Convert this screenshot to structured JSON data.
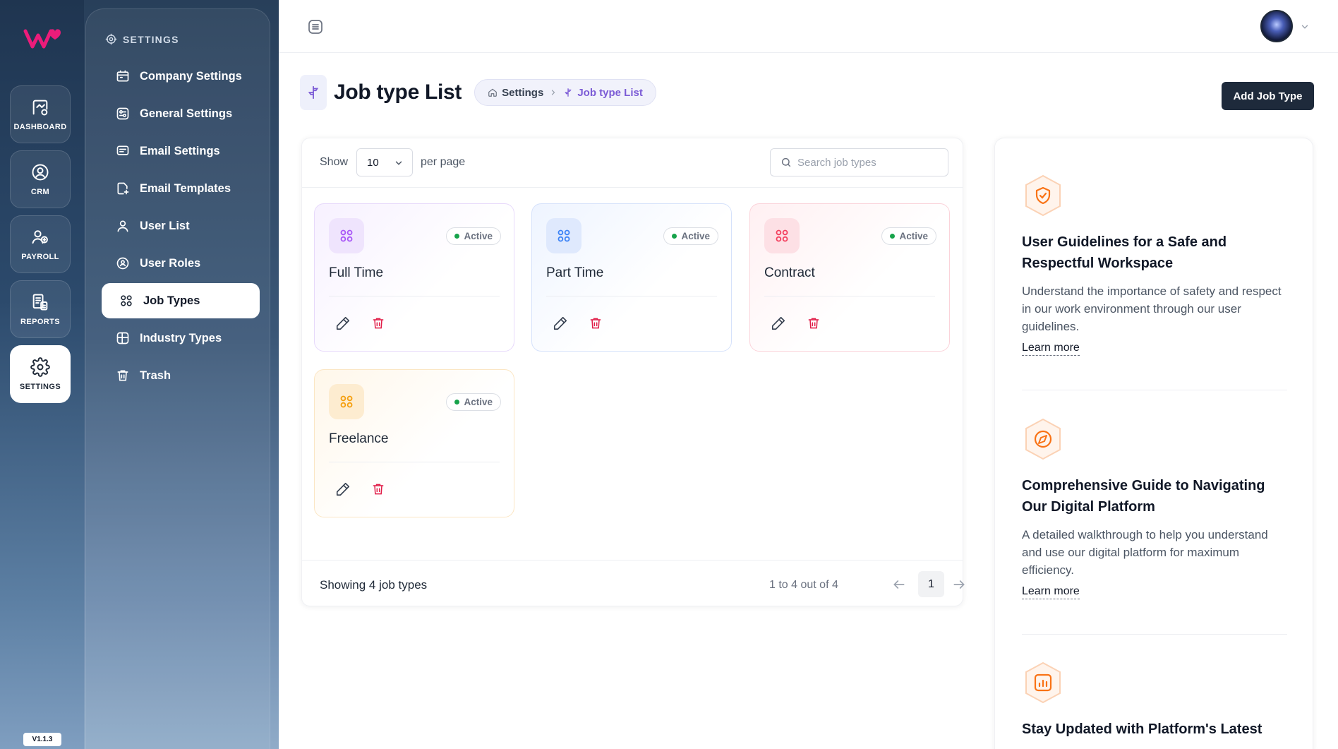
{
  "rail": {
    "items": [
      {
        "label": "DASHBOARD",
        "icon": "dashboard-icon",
        "active": false
      },
      {
        "label": "CRM",
        "icon": "crm-icon",
        "active": false
      },
      {
        "label": "PAYROLL",
        "icon": "payroll-icon",
        "active": false
      },
      {
        "label": "REPORTS",
        "icon": "reports-icon",
        "active": false
      },
      {
        "label": "SETTINGS",
        "icon": "gear-icon",
        "active": true
      }
    ],
    "version": "V1.1.3"
  },
  "settings_panel": {
    "title": "SETTINGS",
    "items": [
      {
        "label": "Company Settings",
        "icon": "building-icon"
      },
      {
        "label": "General Settings",
        "icon": "sliders-icon"
      },
      {
        "label": "Email Settings",
        "icon": "email-icon"
      },
      {
        "label": "Email Templates",
        "icon": "template-icon"
      },
      {
        "label": "User List",
        "icon": "user-icon"
      },
      {
        "label": "User Roles",
        "icon": "shield-icon"
      },
      {
        "label": "Job Types",
        "icon": "grid-icon",
        "active": true
      },
      {
        "label": "Industry Types",
        "icon": "industry-icon"
      },
      {
        "label": "Trash",
        "icon": "trash-icon"
      }
    ]
  },
  "header": {
    "title": "Job type List",
    "breadcrumb": {
      "home": "Settings",
      "current": "Job type List"
    },
    "add_button": "Add Job Type"
  },
  "list": {
    "show_label": "Show",
    "per_page_value": "10",
    "per_page_label": "per page",
    "search_placeholder": "Search job types",
    "items": [
      {
        "name": "Full Time",
        "status": "Active",
        "accent": "#a855f7"
      },
      {
        "name": "Part Time",
        "status": "Active",
        "accent": "#3b82f6"
      },
      {
        "name": "Contract",
        "status": "Active",
        "accent": "#f43f5e"
      },
      {
        "name": "Freelance",
        "status": "Active",
        "accent": "#f59e0b"
      }
    ],
    "footer": {
      "showing": "Showing 4 job types",
      "range": "1 to 4 out of 4",
      "current_page": "1"
    }
  },
  "guides": [
    {
      "title": "User Guidelines for a Safe and Respectful Workspace",
      "description": "Understand the importance of safety and respect in our work environment through our user guidelines.",
      "link": "Learn more",
      "icon": "shield-check-icon"
    },
    {
      "title": "Comprehensive Guide to Navigating Our Digital Platform",
      "description": "A detailed walkthrough to help you understand and use our digital platform for maximum efficiency.",
      "link": "Learn more",
      "icon": "compass-icon"
    },
    {
      "title": "Stay Updated with Platform's Latest",
      "icon": "chart-icon"
    }
  ],
  "colors": {
    "primary_dark": "#1e2a3b",
    "accent_purple": "#7c5cd6",
    "active_green": "#16a34a",
    "delete_red": "#e11d48",
    "guide_orange": "#f97316"
  }
}
